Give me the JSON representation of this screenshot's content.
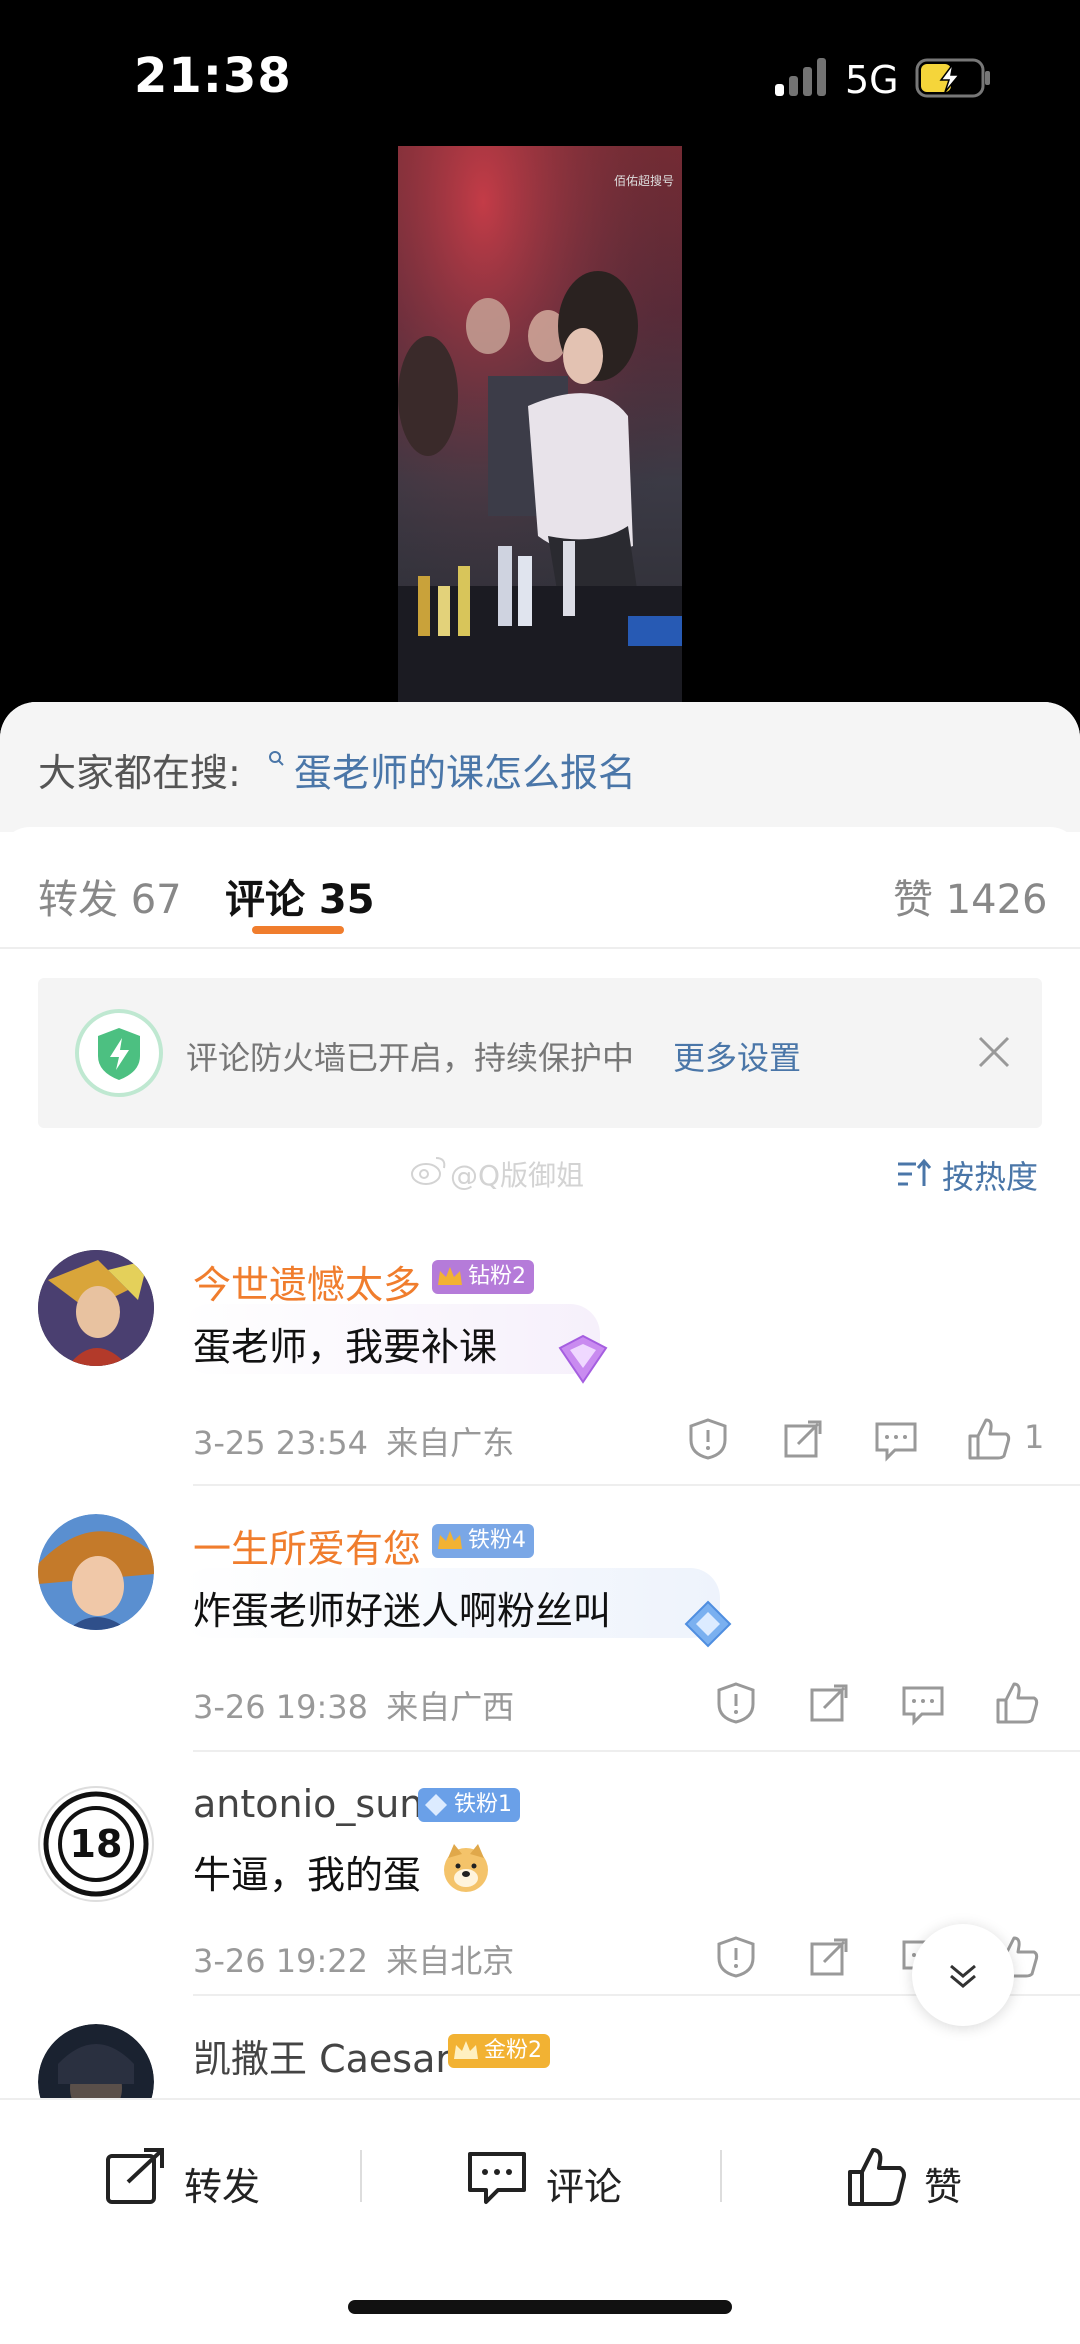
{
  "status_bar": {
    "time": "21:38",
    "network": "5G"
  },
  "video": {
    "watermark": "佰佑超搜号"
  },
  "search": {
    "prefix": "大家都在搜:",
    "query": "蛋老师的课怎么报名"
  },
  "tabs": {
    "repost": "转发 67",
    "comments": "评论 35",
    "likes": "赞 1426"
  },
  "firewall": {
    "text": "评论防火墙已开启，持续保护中",
    "link": "更多设置"
  },
  "watermark_text": "@Q版御姐",
  "sort": {
    "label": "按热度"
  },
  "comments": [
    {
      "username": "今世遗憾太多",
      "badge": "钻粉2",
      "text": "蛋老师，我要补课",
      "time": "3-25 23:54",
      "location": "来自广东",
      "likes": "1",
      "username_color": "#f07d2d",
      "badge_color": "#b57bd9"
    },
    {
      "username": "一生所爱有您",
      "badge": "铁粉4",
      "text": "炸蛋老师好迷人啊粉丝叫",
      "time": "3-26 19:38",
      "location": "来自广西",
      "likes": "",
      "username_color": "#f07d2d",
      "badge_color": "#7aa7e6"
    },
    {
      "username": "antonio_sun",
      "badge": "铁粉1",
      "text": "牛逼，我的蛋",
      "time": "3-26 19:22",
      "location": "来自北京",
      "likes": "",
      "username_color": "#444",
      "badge_color": "#6aa0e8",
      "avatar_number": "18"
    },
    {
      "username": "凯撒王 Caesar",
      "badge": "金粉2",
      "text": "",
      "username_color": "#444",
      "badge_color": "#f2b233"
    }
  ],
  "bottom_bar": {
    "repost": "转发",
    "comment": "评论",
    "like": "赞"
  }
}
